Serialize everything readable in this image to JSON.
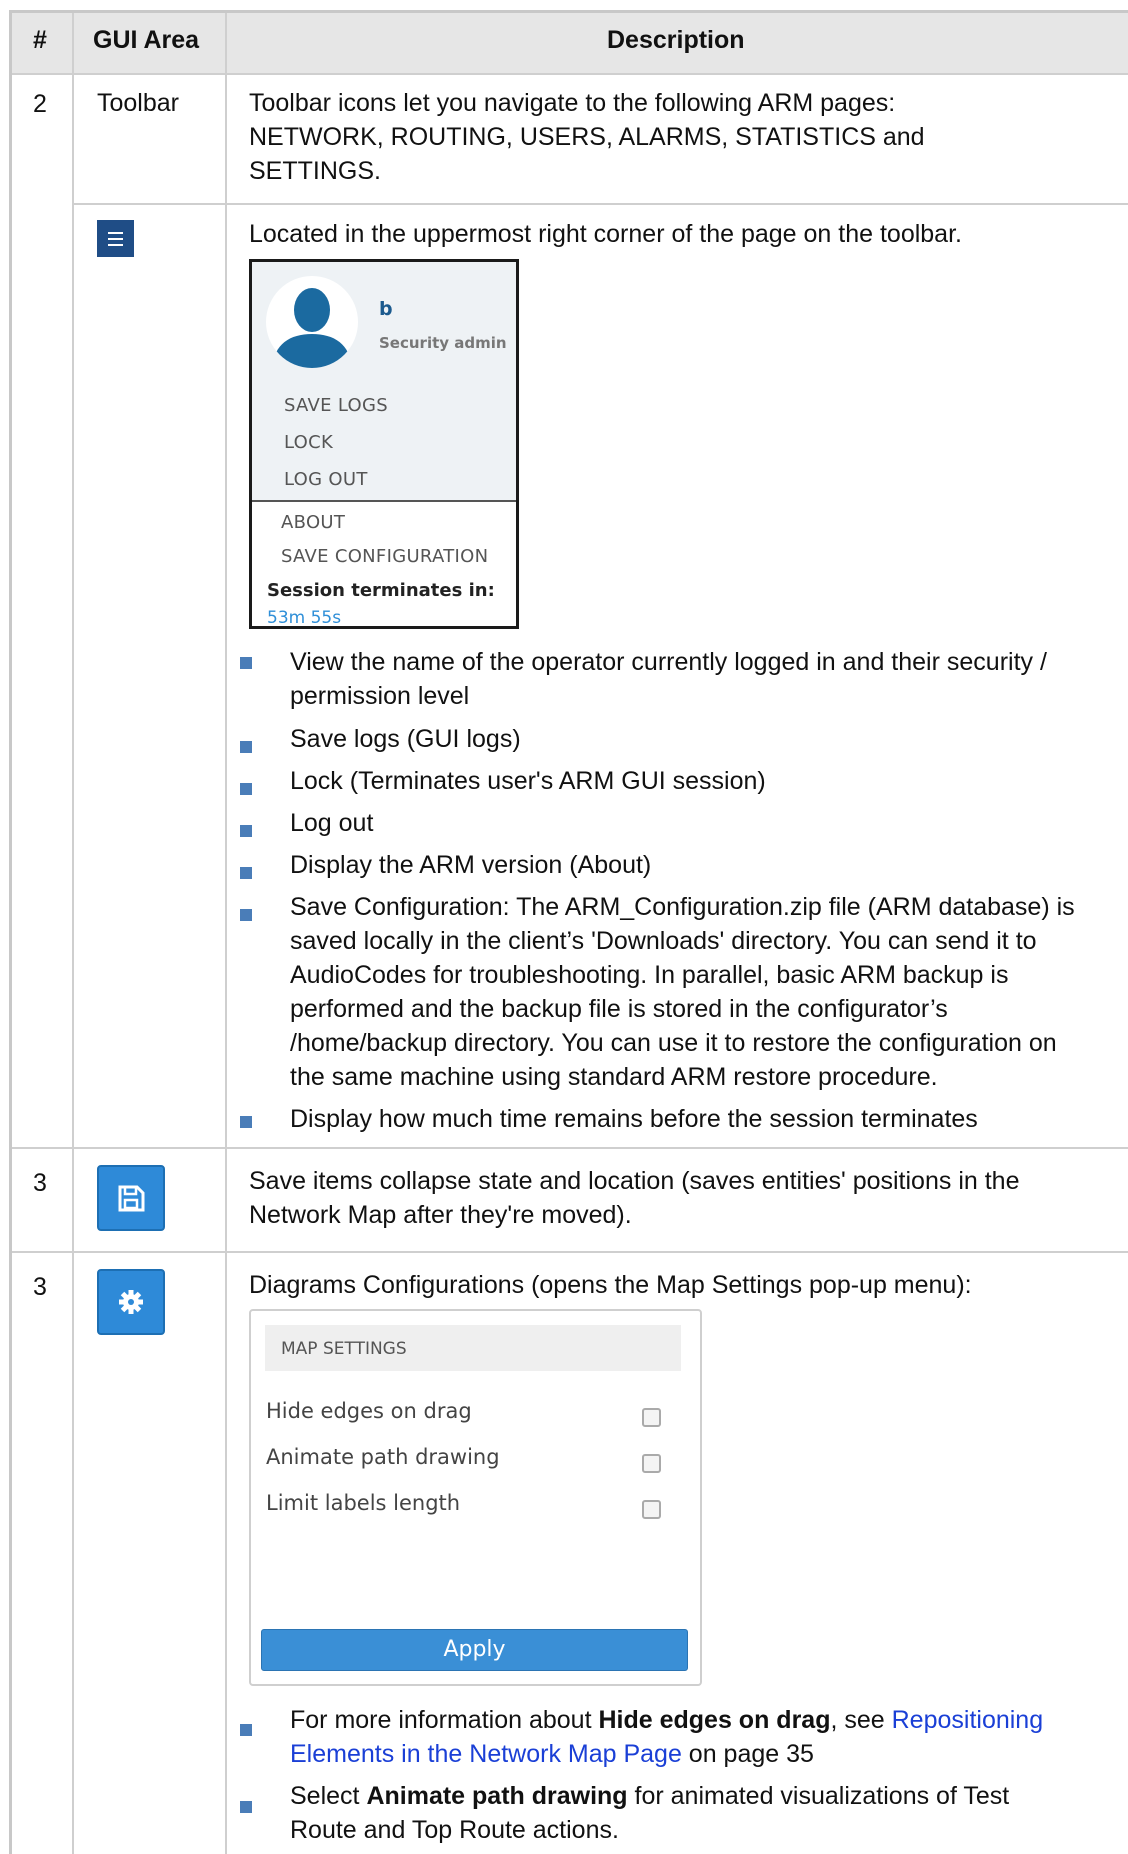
{
  "table": {
    "headers": {
      "num": "#",
      "area": "GUI Area",
      "desc": "Description"
    },
    "row1": {
      "num": "2",
      "area": "Toolbar",
      "desc": [
        "Toolbar icons let you navigate to the following ARM pages:",
        "NETWORK, ROUTING, USERS, ALARMS, STATISTICS and",
        "SETTINGS."
      ]
    },
    "row2": {
      "icon": "hamburger-menu-icon",
      "intro": "Located in the uppermost right corner of the page on the toolbar.",
      "menu": {
        "user": "b",
        "role": "Security admin",
        "items": [
          "SAVE LOGS",
          "LOCK",
          "LOG OUT"
        ],
        "items2": [
          "ABOUT",
          "SAVE CONFIGURATION"
        ],
        "session_label": "Session terminates in:",
        "session_time": "53m 55s",
        "colors": {
          "link": "#2f8fd8",
          "avatar": "#1b6aa0"
        }
      },
      "bullets": [
        [
          "View the name of the operator currently logged in and their security /",
          "permission level"
        ],
        [
          "Save logs (GUI logs)"
        ],
        [
          "Lock (Terminates user's ARM GUI session)"
        ],
        [
          "Log out"
        ],
        [
          "Display the ARM version (About)"
        ],
        [
          "Save Configuration: The ARM_Configuration.zip file (ARM database) is",
          "saved locally in the client’s 'Downloads' directory. You can send it to",
          "AudioCodes for troubleshooting. In parallel, basic ARM backup is",
          "performed and the backup file is stored in the configurator’s",
          "/home/backup directory. You can use it to restore the configuration on",
          "the same machine using standard ARM restore procedure."
        ],
        [
          "Display how much time remains before the session terminates"
        ]
      ]
    },
    "row3": {
      "num": "3",
      "icon": "save-icon",
      "desc": [
        "Save items collapse state and location (saves entities' positions in the",
        "Network Map after they're moved)."
      ]
    },
    "row4": {
      "num": "3",
      "icon": "gear-icon",
      "intro": "Diagrams Configurations (opens the Map Settings pop-up menu):",
      "map": {
        "title": "MAP SETTINGS",
        "options": [
          "Hide edges on drag",
          "Animate path drawing",
          "Limit labels length"
        ],
        "apply": "Apply"
      },
      "b1": {
        "pre": "For more information about ",
        "bold": "Hide edges on drag",
        "mid": ", see ",
        "link1": "Repositioning",
        "link2": "Elements in the Network Map Page",
        "post": " on page 35"
      },
      "b2": {
        "pre": "Select ",
        "bold": "Animate path drawing",
        "post": " for animated visualizations of Test",
        "line2": "Route and Top Route actions."
      }
    },
    "colors": {
      "bullet": "#4a7db8",
      "link": "#1a3fd6",
      "button": "#2e8ad8",
      "header_bg": "#e6e6e6"
    }
  }
}
